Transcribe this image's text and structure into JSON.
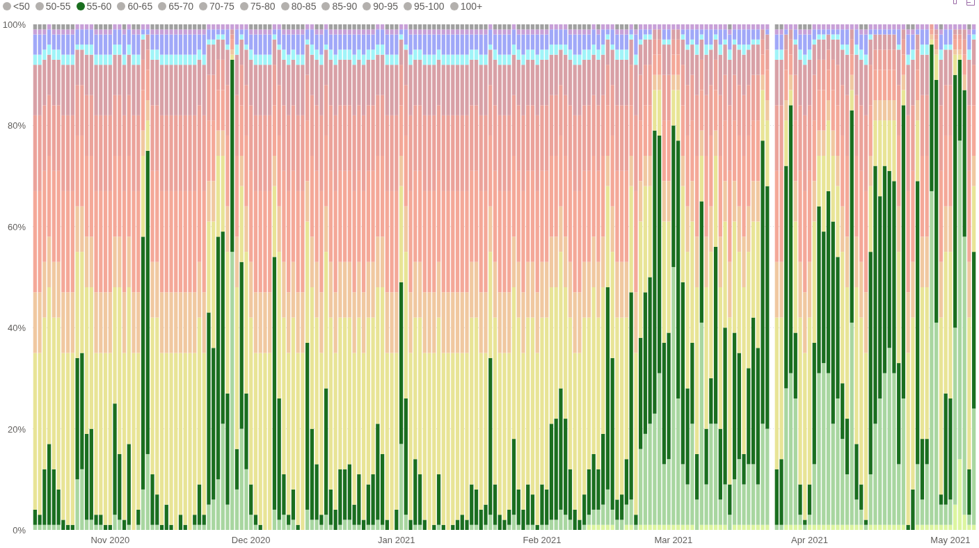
{
  "legend": [
    {
      "selected": false
    },
    {
      "selected": false
    },
    {
      "selected": true
    },
    {
      "selected": false
    },
    {
      "selected": false
    },
    {
      "selected": false
    },
    {
      "selected": false
    },
    {
      "selected": false
    },
    {
      "selected": false
    },
    {
      "selected": false
    },
    {
      "selected": false
    },
    {
      "selected": false
    }
  ],
  "chart_data": {
    "type": "bar",
    "stacked": true,
    "orientation": "vertical",
    "grid": true,
    "ylim": [
      0,
      100
    ],
    "categories": [
      null,
      null,
      null,
      null,
      null,
      null,
      null,
      null,
      null,
      null,
      null,
      null,
      null,
      null,
      null,
      null,
      "Nov 2020",
      null,
      null,
      null,
      null,
      null,
      null,
      null,
      null,
      null,
      null,
      null,
      null,
      null,
      null,
      null,
      null,
      null,
      null,
      null,
      null,
      null,
      null,
      null,
      null,
      null,
      null,
      null,
      null,
      null,
      "Dec 2020",
      null,
      null,
      null,
      null,
      null,
      null,
      null,
      null,
      null,
      null,
      null,
      null,
      null,
      null,
      null,
      null,
      null,
      null,
      null,
      null,
      null,
      null,
      null,
      null,
      null,
      null,
      null,
      null,
      null,
      null,
      "Jan 2021",
      null,
      null,
      null,
      null,
      null,
      null,
      null,
      null,
      null,
      null,
      null,
      null,
      null,
      null,
      null,
      null,
      null,
      null,
      null,
      null,
      null,
      null,
      null,
      null,
      null,
      null,
      null,
      null,
      null,
      null,
      "Feb 2021",
      null,
      null,
      null,
      null,
      null,
      null,
      null,
      null,
      null,
      null,
      null,
      null,
      null,
      null,
      null,
      null,
      null,
      null,
      null,
      null,
      null,
      null,
      null,
      null,
      null,
      null,
      null,
      "Mar 2021",
      null,
      null,
      null,
      null,
      null,
      null,
      null,
      null,
      null,
      null,
      null,
      null,
      null,
      null,
      null,
      null,
      null,
      null,
      null,
      null,
      null,
      null,
      null,
      null,
      null,
      null,
      null,
      null,
      "Apr 2021",
      null,
      null,
      null,
      null,
      null,
      null,
      null,
      null,
      null,
      null,
      null,
      null,
      null,
      null,
      null,
      null,
      null,
      null,
      null,
      null,
      null,
      null,
      null,
      null,
      null,
      null,
      null,
      null,
      null,
      "May 2021",
      null,
      null,
      null,
      null,
      null
    ],
    "yticks": [
      {
        "value": 0,
        "label": "0%"
      },
      {
        "value": 20,
        "label": "20%"
      },
      {
        "value": 40,
        "label": "40%"
      },
      {
        "value": 60,
        "label": "60%"
      },
      {
        "value": 80,
        "label": "80%"
      },
      {
        "value": 100,
        "label": "100%"
      }
    ],
    "series": [
      {
        "name": "<50",
        "color": "#dcf5a0",
        "values": [
          0,
          0,
          0,
          0,
          0,
          0,
          0,
          0,
          0,
          0,
          0,
          0,
          0,
          0,
          0,
          0,
          0,
          0,
          0,
          0,
          0,
          0,
          0,
          0,
          0,
          0,
          0,
          0,
          0,
          0,
          0,
          0,
          0,
          0,
          0,
          0,
          0,
          0,
          0,
          0,
          0,
          0,
          0,
          0,
          0,
          0,
          0,
          0,
          0,
          0,
          0,
          0,
          0,
          0,
          0,
          0,
          0,
          0,
          0,
          0,
          0,
          0,
          0,
          0,
          0,
          0,
          0,
          0,
          0,
          0,
          0,
          0,
          0,
          0,
          0,
          0,
          0,
          0,
          0,
          0,
          0,
          0,
          0,
          0,
          0,
          0,
          0,
          0,
          0,
          0,
          0,
          0,
          0,
          0,
          0,
          0,
          0,
          0,
          0,
          0,
          0,
          0,
          0,
          0,
          0,
          0,
          0,
          0,
          0,
          0,
          0,
          0,
          0,
          0,
          0,
          0,
          0,
          0,
          1,
          1,
          1,
          1,
          1,
          1,
          0,
          0,
          1,
          1,
          0,
          1,
          1,
          1,
          1,
          1,
          1,
          1,
          1,
          1,
          1,
          1,
          1,
          0,
          1,
          1,
          1,
          1,
          1,
          1,
          0,
          1,
          1,
          1,
          1,
          1,
          1,
          1,
          1,
          null,
          0,
          0,
          1,
          1,
          1,
          1,
          0,
          1,
          1,
          1,
          1,
          1,
          1,
          1,
          1,
          1,
          1,
          1,
          1,
          0,
          1,
          1,
          1,
          1,
          1,
          1,
          1,
          1,
          0,
          0,
          1,
          1,
          1,
          1,
          1,
          1,
          1,
          1,
          5,
          14,
          3,
          1,
          1
        ]
      },
      {
        "name": "50-55",
        "color": "#a8d6a0",
        "values": [
          1,
          1,
          1,
          1,
          1,
          1,
          0,
          0,
          0,
          10,
          12,
          2,
          2,
          1,
          1,
          0,
          0,
          3,
          2,
          0,
          1,
          0,
          1,
          8,
          15,
          1,
          1,
          0,
          0,
          0,
          0,
          0,
          0,
          0,
          1,
          1,
          1,
          5,
          6,
          10,
          21,
          5,
          55,
          8,
          20,
          12,
          3,
          1,
          0,
          0,
          0,
          4,
          2,
          3,
          1,
          2,
          0,
          0,
          4,
          2,
          2,
          1,
          3,
          1,
          0,
          1,
          2,
          2,
          1,
          1,
          0,
          1,
          1,
          2,
          1,
          0,
          0,
          0,
          17,
          3,
          0,
          1,
          1,
          0,
          0,
          0,
          1,
          0,
          0,
          0,
          0,
          0,
          0,
          1,
          1,
          0,
          1,
          3,
          1,
          0,
          0,
          1,
          3,
          1,
          0,
          1,
          1,
          0,
          1,
          1,
          2,
          2,
          4,
          3,
          2,
          0,
          0,
          1,
          2,
          3,
          3,
          4,
          7,
          3,
          2,
          2,
          4,
          5,
          1,
          15,
          18,
          20,
          22,
          30,
          12,
          13,
          51,
          25,
          12,
          8,
          20,
          6,
          40,
          8,
          20,
          20,
          5,
          8,
          3,
          9,
          13,
          8,
          12,
          12,
          8,
          20,
          19,
          null,
          1,
          1,
          27,
          30,
          25,
          2,
          1,
          2,
          12,
          30,
          32,
          30,
          20,
          25,
          17,
          10,
          40,
          5,
          3,
          1,
          10,
          20,
          25,
          30,
          35,
          30,
          12,
          25,
          0,
          0,
          12,
          5,
          12,
          66,
          40,
          4,
          4,
          5,
          35,
          63,
          55,
          2,
          23
        ]
      },
      {
        "name": "55-60",
        "color": "#1a6e1f",
        "values": [
          3,
          2,
          11,
          16,
          11,
          7,
          2,
          1,
          1,
          24,
          23,
          17,
          18,
          2,
          2,
          1,
          1,
          22,
          13,
          2,
          16,
          0,
          3,
          50,
          60,
          10,
          6,
          1,
          5,
          1,
          0,
          3,
          1,
          0,
          2,
          8,
          2,
          38,
          30,
          48,
          38,
          22,
          38,
          8,
          33,
          15,
          6,
          2,
          1,
          0,
          0,
          50,
          24,
          8,
          2,
          6,
          1,
          0,
          33,
          18,
          11,
          2,
          25,
          7,
          4,
          11,
          10,
          11,
          4,
          10,
          2,
          8,
          10,
          19,
          14,
          2,
          0,
          4,
          32,
          23,
          2,
          13,
          10,
          2,
          0,
          1,
          10,
          1,
          0,
          1,
          2,
          3,
          2,
          8,
          7,
          4,
          4,
          31,
          8,
          3,
          2,
          3,
          15,
          7,
          4,
          8,
          6,
          1,
          8,
          7,
          19,
          20,
          24,
          19,
          10,
          4,
          2,
          6,
          9,
          11,
          8,
          14,
          40,
          30,
          4,
          5,
          9,
          41,
          2,
          22,
          28,
          29,
          56,
          47,
          24,
          25,
          28,
          51,
          36,
          19,
          16,
          9,
          24,
          11,
          9,
          35,
          14,
          31,
          6,
          29,
          21,
          6,
          19,
          29,
          27,
          56,
          48,
          null,
          11,
          13,
          44,
          53,
          13,
          6,
          1,
          6,
          24,
          33,
          26,
          36,
          40,
          28,
          11,
          11,
          42,
          11,
          5,
          1,
          44,
          51,
          40,
          41,
          35,
          38,
          20,
          58,
          1,
          8,
          56,
          12,
          5,
          29,
          48,
          2,
          22,
          20,
          50,
          16,
          29,
          9,
          31
        ]
      },
      {
        "name": "60-65",
        "color": "#e8e496",
        "values": [
          31,
          32,
          30,
          31,
          30,
          34,
          33,
          34,
          34,
          21,
          20,
          29,
          28,
          32,
          32,
          34,
          34,
          23,
          33,
          33,
          31,
          35,
          31,
          16,
          6,
          31,
          35,
          34,
          30,
          34,
          35,
          32,
          34,
          35,
          32,
          33,
          32,
          18,
          25,
          16,
          15,
          28,
          1,
          32,
          15,
          28,
          33,
          32,
          34,
          35,
          35,
          14,
          29,
          31,
          32,
          34,
          34,
          35,
          24,
          28,
          29,
          32,
          27,
          34,
          31,
          30,
          30,
          29,
          30,
          31,
          33,
          33,
          31,
          27,
          33,
          33,
          35,
          31,
          19,
          29,
          33,
          28,
          31,
          33,
          35,
          34,
          31,
          34,
          35,
          34,
          33,
          32,
          33,
          33,
          34,
          31,
          30,
          21,
          33,
          32,
          33,
          31,
          30,
          34,
          31,
          33,
          35,
          34,
          33,
          34,
          27,
          26,
          27,
          26,
          30,
          31,
          33,
          35,
          30,
          33,
          30,
          29,
          20,
          21,
          36,
          35,
          28,
          21,
          32,
          23,
          21,
          18,
          8,
          9,
          24,
          22,
          7,
          10,
          19,
          27,
          24,
          33,
          9,
          28,
          25,
          18,
          28,
          21,
          33,
          22,
          20,
          33,
          23,
          19,
          25,
          10,
          13,
          null,
          30,
          28,
          9,
          3,
          22,
          33,
          33,
          33,
          24,
          10,
          15,
          14,
          13,
          14,
          26,
          26,
          4,
          31,
          33,
          33,
          13,
          9,
          15,
          9,
          10,
          12,
          22,
          3,
          34,
          34,
          12,
          30,
          30,
          1,
          5,
          35,
          28,
          29,
          4,
          1,
          0,
          30,
          13
        ]
      },
      {
        "name": "65-70",
        "color": "#f0c8a0",
        "values": [
          12,
          12,
          11,
          10,
          11,
          11,
          12,
          12,
          12,
          9,
          9,
          10,
          10,
          12,
          12,
          12,
          12,
          10,
          10,
          12,
          10,
          12,
          12,
          5,
          4,
          11,
          11,
          12,
          12,
          12,
          12,
          12,
          12,
          12,
          12,
          11,
          12,
          8,
          8,
          5,
          5,
          9,
          1,
          10,
          6,
          9,
          11,
          12,
          12,
          12,
          12,
          6,
          9,
          11,
          12,
          11,
          12,
          12,
          8,
          10,
          11,
          12,
          9,
          11,
          12,
          11,
          11,
          11,
          12,
          11,
          12,
          11,
          11,
          10,
          10,
          12,
          12,
          12,
          6,
          9,
          12,
          11,
          11,
          12,
          12,
          12,
          11,
          12,
          12,
          12,
          12,
          12,
          12,
          11,
          11,
          12,
          12,
          9,
          11,
          12,
          12,
          12,
          10,
          11,
          12,
          11,
          11,
          12,
          11,
          11,
          10,
          10,
          9,
          10,
          11,
          12,
          12,
          11,
          11,
          10,
          11,
          10,
          6,
          9,
          11,
          11,
          11,
          6,
          12,
          8,
          6,
          6,
          3,
          3,
          8,
          8,
          3,
          3,
          6,
          9,
          8,
          10,
          5,
          10,
          9,
          5,
          10,
          8,
          11,
          8,
          9,
          10,
          9,
          8,
          8,
          3,
          4,
          null,
          11,
          11,
          4,
          3,
          8,
          11,
          12,
          11,
          8,
          5,
          5,
          4,
          5,
          6,
          9,
          10,
          3,
          10,
          11,
          12,
          6,
          4,
          4,
          4,
          4,
          4,
          9,
          3,
          12,
          11,
          4,
          10,
          10,
          1,
          1,
          11,
          9,
          9,
          1,
          1,
          3,
          11,
          6
        ]
      },
      {
        "name": "70-75",
        "color": "#f4a898",
        "values": [
          20,
          20,
          18,
          16,
          18,
          18,
          20,
          20,
          20,
          14,
          14,
          16,
          16,
          20,
          20,
          20,
          20,
          16,
          16,
          20,
          16,
          20,
          20,
          8,
          6,
          18,
          18,
          20,
          20,
          20,
          20,
          20,
          20,
          20,
          20,
          18,
          20,
          12,
          12,
          8,
          8,
          14,
          2,
          16,
          10,
          14,
          18,
          20,
          20,
          20,
          20,
          10,
          14,
          18,
          20,
          18,
          20,
          20,
          12,
          16,
          18,
          20,
          14,
          18,
          20,
          18,
          18,
          18,
          20,
          18,
          20,
          18,
          18,
          16,
          16,
          20,
          20,
          20,
          10,
          14,
          20,
          18,
          18,
          20,
          20,
          20,
          18,
          20,
          20,
          20,
          20,
          20,
          20,
          18,
          18,
          20,
          20,
          14,
          18,
          20,
          20,
          20,
          16,
          18,
          20,
          18,
          18,
          20,
          18,
          18,
          16,
          16,
          14,
          16,
          18,
          20,
          20,
          18,
          18,
          16,
          18,
          16,
          10,
          14,
          18,
          18,
          18,
          10,
          20,
          12,
          10,
          10,
          4,
          4,
          12,
          12,
          4,
          4,
          10,
          14,
          12,
          16,
          8,
          16,
          14,
          8,
          16,
          12,
          18,
          12,
          14,
          16,
          14,
          12,
          12,
          4,
          6,
          null,
          18,
          18,
          6,
          4,
          12,
          18,
          20,
          18,
          12,
          8,
          8,
          6,
          8,
          10,
          14,
          16,
          4,
          16,
          18,
          20,
          10,
          6,
          6,
          6,
          6,
          6,
          14,
          4,
          20,
          18,
          6,
          16,
          16,
          1,
          2,
          18,
          14,
          14,
          2,
          2,
          4,
          18,
          10
        ]
      },
      {
        "name": "75-80",
        "color": "#eba29a",
        "values": [
          15,
          15,
          13,
          12,
          13,
          13,
          15,
          15,
          15,
          10,
          10,
          12,
          12,
          15,
          15,
          15,
          15,
          12,
          12,
          15,
          12,
          15,
          15,
          6,
          4,
          13,
          13,
          15,
          15,
          15,
          15,
          15,
          15,
          15,
          15,
          13,
          15,
          9,
          9,
          6,
          6,
          10,
          1,
          12,
          8,
          10,
          13,
          15,
          15,
          15,
          15,
          8,
          10,
          13,
          15,
          13,
          15,
          15,
          9,
          12,
          13,
          15,
          10,
          13,
          15,
          13,
          13,
          13,
          15,
          13,
          15,
          13,
          13,
          12,
          12,
          15,
          15,
          15,
          8,
          10,
          15,
          13,
          13,
          15,
          15,
          15,
          13,
          15,
          15,
          15,
          15,
          15,
          15,
          13,
          13,
          15,
          15,
          10,
          13,
          15,
          15,
          15,
          12,
          13,
          15,
          13,
          13,
          15,
          13,
          13,
          12,
          12,
          10,
          12,
          13,
          15,
          15,
          13,
          13,
          12,
          13,
          12,
          8,
          10,
          13,
          13,
          13,
          8,
          15,
          9,
          8,
          8,
          3,
          3,
          9,
          9,
          3,
          3,
          8,
          10,
          9,
          12,
          6,
          12,
          10,
          6,
          12,
          9,
          13,
          9,
          10,
          12,
          10,
          9,
          9,
          3,
          4,
          null,
          13,
          13,
          4,
          3,
          9,
          13,
          15,
          13,
          9,
          6,
          6,
          4,
          6,
          8,
          10,
          12,
          3,
          12,
          13,
          15,
          8,
          4,
          4,
          4,
          4,
          4,
          10,
          3,
          15,
          13,
          4,
          12,
          12,
          1,
          1,
          13,
          10,
          10,
          1,
          1,
          3,
          13,
          8
        ]
      },
      {
        "name": "80-85",
        "color": "#d8a0a6",
        "values": [
          10,
          10,
          9,
          8,
          9,
          9,
          10,
          10,
          10,
          7,
          7,
          8,
          8,
          10,
          10,
          10,
          10,
          8,
          8,
          10,
          8,
          10,
          10,
          4,
          3,
          9,
          9,
          10,
          10,
          10,
          10,
          10,
          10,
          10,
          10,
          9,
          10,
          6,
          6,
          4,
          4,
          7,
          1,
          8,
          5,
          7,
          9,
          10,
          10,
          10,
          10,
          5,
          7,
          9,
          10,
          9,
          10,
          10,
          6,
          8,
          9,
          10,
          7,
          9,
          10,
          9,
          9,
          9,
          10,
          9,
          10,
          9,
          9,
          8,
          8,
          10,
          10,
          10,
          5,
          7,
          10,
          9,
          9,
          10,
          10,
          10,
          9,
          10,
          10,
          10,
          10,
          10,
          10,
          9,
          9,
          10,
          10,
          7,
          9,
          10,
          10,
          10,
          8,
          9,
          10,
          9,
          9,
          10,
          9,
          9,
          8,
          8,
          7,
          8,
          9,
          10,
          10,
          9,
          9,
          8,
          9,
          8,
          5,
          7,
          9,
          9,
          9,
          5,
          10,
          6,
          5,
          5,
          2,
          2,
          6,
          6,
          2,
          2,
          5,
          7,
          6,
          8,
          4,
          8,
          7,
          4,
          8,
          6,
          9,
          6,
          7,
          8,
          7,
          6,
          6,
          2,
          3,
          null,
          9,
          9,
          3,
          2,
          6,
          9,
          10,
          9,
          6,
          4,
          4,
          3,
          4,
          5,
          7,
          8,
          2,
          8,
          9,
          10,
          5,
          3,
          3,
          3,
          3,
          3,
          7,
          2,
          10,
          9,
          3,
          8,
          8,
          0,
          1,
          9,
          7,
          7,
          1,
          1,
          2,
          9,
          5
        ]
      },
      {
        "name": "85-90",
        "color": "#a0f4f8",
        "values": [
          2,
          2,
          2,
          2,
          2,
          2,
          2,
          2,
          2,
          1,
          1,
          2,
          2,
          2,
          2,
          2,
          2,
          2,
          2,
          2,
          2,
          2,
          2,
          1,
          0,
          2,
          2,
          2,
          2,
          2,
          2,
          2,
          2,
          2,
          2,
          2,
          2,
          1,
          1,
          1,
          1,
          1,
          0,
          2,
          1,
          1,
          2,
          2,
          2,
          2,
          2,
          1,
          1,
          2,
          2,
          2,
          2,
          2,
          1,
          2,
          2,
          2,
          1,
          2,
          2,
          2,
          2,
          2,
          2,
          2,
          2,
          2,
          2,
          2,
          2,
          2,
          2,
          2,
          1,
          1,
          2,
          2,
          2,
          2,
          2,
          2,
          2,
          2,
          2,
          2,
          2,
          2,
          2,
          2,
          2,
          2,
          2,
          1,
          2,
          2,
          2,
          2,
          2,
          2,
          2,
          2,
          2,
          2,
          2,
          2,
          2,
          2,
          1,
          2,
          2,
          2,
          2,
          2,
          2,
          2,
          2,
          2,
          1,
          1,
          2,
          2,
          2,
          1,
          2,
          1,
          1,
          1,
          0,
          0,
          1,
          1,
          0,
          0,
          1,
          1,
          1,
          2,
          1,
          2,
          1,
          1,
          2,
          1,
          2,
          1,
          1,
          2,
          1,
          1,
          1,
          0,
          0,
          null,
          2,
          2,
          0,
          0,
          1,
          2,
          2,
          2,
          1,
          1,
          1,
          0,
          1,
          1,
          1,
          2,
          0,
          2,
          2,
          2,
          1,
          0,
          0,
          0,
          0,
          0,
          1,
          0,
          2,
          2,
          0,
          2,
          2,
          0,
          0,
          2,
          1,
          1,
          0,
          0,
          0,
          2,
          1
        ]
      },
      {
        "name": "90-95",
        "color": "#a0a8f8",
        "values": [
          4,
          4,
          3,
          3,
          3,
          3,
          4,
          4,
          4,
          3,
          3,
          3,
          3,
          4,
          4,
          4,
          4,
          3,
          3,
          4,
          3,
          4,
          4,
          1,
          1,
          3,
          3,
          4,
          4,
          4,
          4,
          4,
          4,
          4,
          4,
          3,
          4,
          2,
          2,
          1,
          1,
          3,
          0,
          3,
          1,
          3,
          3,
          4,
          4,
          4,
          4,
          1,
          3,
          3,
          4,
          3,
          4,
          4,
          2,
          3,
          3,
          4,
          3,
          3,
          4,
          3,
          3,
          3,
          4,
          3,
          4,
          3,
          3,
          3,
          3,
          4,
          4,
          4,
          1,
          3,
          4,
          3,
          3,
          4,
          4,
          4,
          3,
          4,
          4,
          4,
          4,
          4,
          4,
          3,
          3,
          4,
          4,
          3,
          3,
          4,
          4,
          4,
          3,
          3,
          4,
          3,
          3,
          4,
          3,
          3,
          3,
          3,
          3,
          3,
          3,
          4,
          4,
          3,
          3,
          3,
          3,
          3,
          1,
          3,
          3,
          3,
          3,
          1,
          4,
          2,
          1,
          1,
          0,
          0,
          2,
          2,
          0,
          0,
          1,
          3,
          2,
          3,
          1,
          3,
          3,
          1,
          3,
          2,
          3,
          2,
          3,
          3,
          3,
          2,
          2,
          0,
          1,
          null,
          3,
          3,
          1,
          0,
          2,
          3,
          4,
          3,
          2,
          1,
          1,
          1,
          1,
          1,
          3,
          3,
          0,
          3,
          3,
          4,
          1,
          1,
          1,
          1,
          1,
          1,
          3,
          0,
          4,
          3,
          1,
          3,
          3,
          0,
          0,
          3,
          3,
          3,
          0,
          0,
          0,
          3,
          1
        ]
      },
      {
        "name": "95-100",
        "color": "#c8a0d8",
        "values": [
          1,
          1,
          1,
          1,
          1,
          1,
          1,
          1,
          1,
          1,
          1,
          1,
          1,
          1,
          1,
          1,
          1,
          1,
          1,
          1,
          1,
          1,
          1,
          1,
          1,
          1,
          1,
          1,
          1,
          1,
          1,
          1,
          1,
          1,
          1,
          1,
          1,
          1,
          1,
          1,
          1,
          1,
          1,
          1,
          1,
          1,
          1,
          1,
          1,
          1,
          1,
          1,
          1,
          1,
          1,
          1,
          1,
          1,
          1,
          1,
          1,
          1,
          1,
          1,
          1,
          1,
          1,
          1,
          1,
          1,
          1,
          1,
          1,
          1,
          1,
          1,
          1,
          1,
          1,
          1,
          1,
          1,
          1,
          1,
          1,
          1,
          1,
          1,
          1,
          1,
          1,
          1,
          1,
          1,
          1,
          1,
          1,
          1,
          1,
          1,
          1,
          1,
          1,
          1,
          1,
          1,
          1,
          1,
          1,
          1,
          1,
          1,
          1,
          1,
          1,
          1,
          1,
          1,
          1,
          1,
          1,
          1,
          1,
          1,
          1,
          1,
          1,
          1,
          1,
          1,
          1,
          1,
          1,
          1,
          1,
          1,
          1,
          1,
          1,
          1,
          1,
          1,
          1,
          1,
          1,
          1,
          1,
          1,
          1,
          1,
          1,
          1,
          1,
          1,
          1,
          1,
          1,
          null,
          1,
          1,
          1,
          1,
          1,
          1,
          1,
          1,
          1,
          1,
          1,
          1,
          1,
          1,
          1,
          1,
          1,
          1,
          1,
          1,
          1,
          1,
          1,
          1,
          1,
          1,
          1,
          1,
          1,
          1,
          1,
          1,
          1,
          0,
          1,
          1,
          1,
          1,
          1,
          1,
          1,
          1,
          1
        ]
      },
      {
        "name": "100+",
        "color": "#a0a0a0",
        "values": [
          1,
          1,
          1,
          0,
          1,
          1,
          1,
          1,
          1,
          0,
          0,
          0,
          0,
          1,
          1,
          1,
          1,
          0,
          0,
          1,
          0,
          1,
          1,
          0,
          0,
          1,
          1,
          1,
          1,
          1,
          1,
          1,
          1,
          1,
          1,
          1,
          1,
          0,
          0,
          0,
          0,
          0,
          0,
          0,
          0,
          0,
          1,
          1,
          1,
          1,
          1,
          0,
          0,
          1,
          1,
          1,
          1,
          1,
          0,
          0,
          1,
          1,
          0,
          1,
          1,
          1,
          1,
          1,
          1,
          1,
          1,
          1,
          1,
          0,
          0,
          1,
          1,
          1,
          0,
          0,
          1,
          1,
          1,
          1,
          1,
          1,
          1,
          1,
          1,
          1,
          1,
          1,
          1,
          1,
          1,
          1,
          1,
          0,
          1,
          1,
          1,
          1,
          0,
          1,
          1,
          1,
          1,
          1,
          1,
          1,
          0,
          0,
          0,
          0,
          1,
          1,
          1,
          1,
          1,
          0,
          1,
          0,
          0,
          0,
          1,
          1,
          1,
          0,
          1,
          0,
          0,
          0,
          0,
          0,
          0,
          0,
          0,
          0,
          0,
          0,
          0,
          0,
          0,
          0,
          0,
          0,
          0,
          0,
          1,
          0,
          0,
          0,
          0,
          0,
          0,
          0,
          0,
          null,
          1,
          1,
          0,
          0,
          0,
          1,
          1,
          1,
          0,
          0,
          0,
          0,
          0,
          0,
          0,
          0,
          0,
          0,
          1,
          1,
          0,
          0,
          0,
          0,
          0,
          0,
          0,
          0,
          1,
          1,
          0,
          0,
          0,
          0,
          0,
          1,
          0,
          0,
          0,
          0,
          0,
          1,
          0
        ]
      }
    ]
  }
}
